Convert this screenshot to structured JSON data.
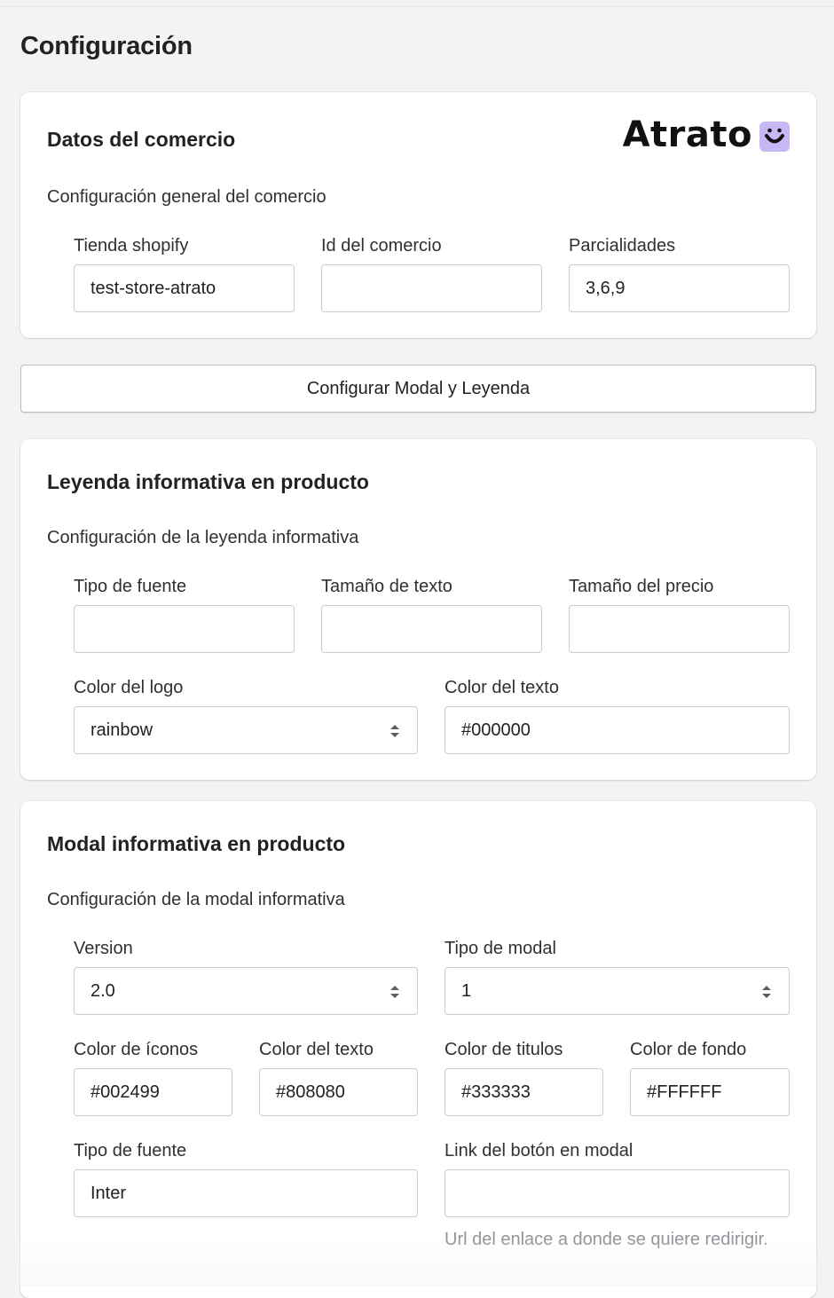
{
  "page": {
    "title": "Configuración"
  },
  "merchant": {
    "title": "Datos del comercio",
    "subtitle": "Configuración general del comercio",
    "logo_text": "Atrato",
    "logo_color": "#C8B7F5",
    "fields": {
      "store": {
        "label": "Tienda shopify",
        "value": "test-store-atrato"
      },
      "merchant_id": {
        "label": "Id del comercio",
        "value": ""
      },
      "installments": {
        "label": "Parcialidades",
        "value": "3,6,9"
      }
    }
  },
  "config_button": {
    "label": "Configurar Modal y Leyenda"
  },
  "legend": {
    "title": "Leyenda informativa en producto",
    "subtitle": "Configuración de la leyenda informativa",
    "fields": {
      "font_type": {
        "label": "Tipo de fuente",
        "value": ""
      },
      "text_size": {
        "label": "Tamaño de texto",
        "value": ""
      },
      "price_size": {
        "label": "Tamaño del precio",
        "value": ""
      },
      "logo_color": {
        "label": "Color del logo",
        "value": "rainbow"
      },
      "text_color": {
        "label": "Color del texto",
        "value": "#000000"
      }
    }
  },
  "modal": {
    "title": "Modal informativa en producto",
    "subtitle": "Configuración de la modal informativa",
    "fields": {
      "version": {
        "label": "Version",
        "value": "2.0"
      },
      "modal_type": {
        "label": "Tipo de modal",
        "value": "1"
      },
      "icon_color": {
        "label": "Color de íconos",
        "value": "#002499"
      },
      "text_color": {
        "label": "Color del texto",
        "value": "#808080"
      },
      "title_color": {
        "label": "Color de titulos",
        "value": "#333333"
      },
      "bg_color": {
        "label": "Color de fondo",
        "value": "#FFFFFF"
      },
      "font_type": {
        "label": "Tipo de fuente",
        "value": "Inter"
      },
      "button_link": {
        "label": "Link del botón en modal",
        "value": "",
        "help": "Url del enlace a donde se quiere redirigir."
      }
    }
  }
}
